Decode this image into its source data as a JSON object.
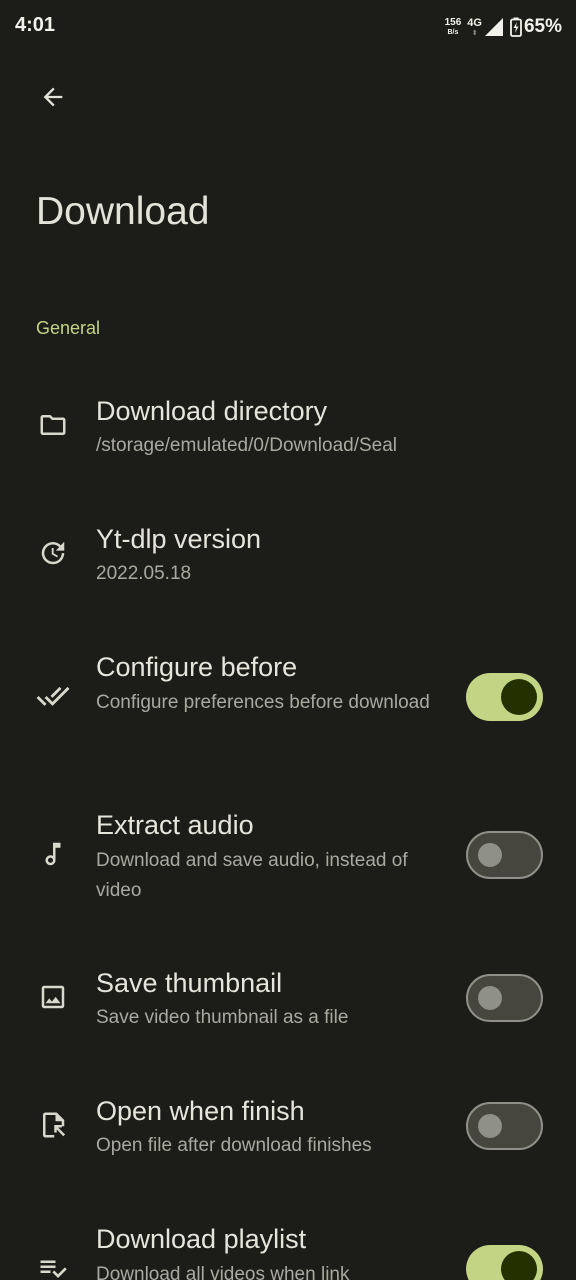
{
  "status_bar": {
    "time": "4:01",
    "net_speed_value": "156",
    "net_speed_unit": "B/s",
    "network_type": "4G",
    "battery_percent": "65%"
  },
  "header": {
    "back_icon": "arrow-back-icon",
    "title": "Download"
  },
  "section": {
    "title": "General"
  },
  "settings": [
    {
      "icon": "folder-icon",
      "title": "Download directory",
      "description": "/storage/emulated/0/Download/Seal"
    },
    {
      "icon": "update-icon",
      "title": "Yt-dlp version",
      "description": "2022.05.18"
    },
    {
      "icon": "done-all-icon",
      "title": "Configure before",
      "description": "Configure preferences before download",
      "toggle": "on"
    },
    {
      "icon": "music-note-icon",
      "title": "Extract audio",
      "description": "Download and save audio, instead of video",
      "toggle": "off"
    },
    {
      "icon": "image-icon",
      "title": "Save thumbnail",
      "description": "Save video thumbnail as a file",
      "toggle": "off"
    },
    {
      "icon": "file-open-icon",
      "title": "Open when finish",
      "description": "Open file after download finishes",
      "toggle": "off"
    },
    {
      "icon": "playlist-add-check-icon",
      "title": "Download playlist",
      "description": "Download all videos when link",
      "toggle": "on"
    }
  ],
  "colors": {
    "background": "#1c1d18",
    "accent": "#c3d584",
    "toggle_on_knob": "#233100",
    "toggle_off_track": "#46463f"
  }
}
